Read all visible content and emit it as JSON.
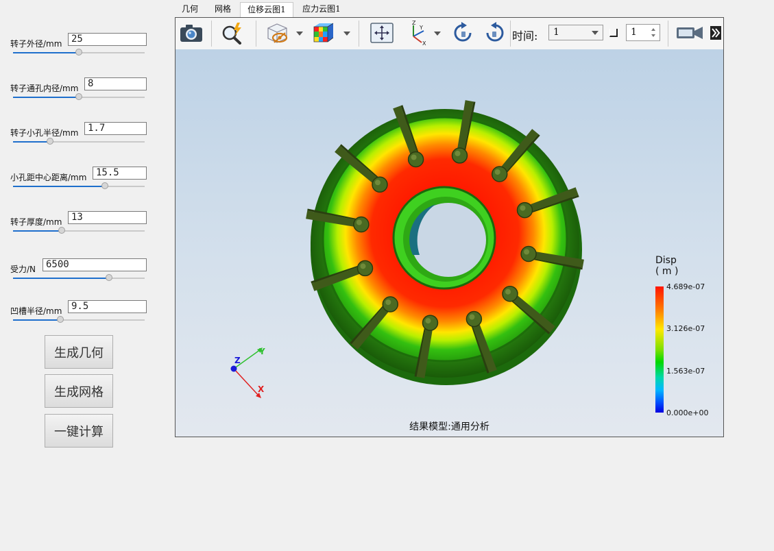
{
  "tabs": [
    {
      "label": "几何"
    },
    {
      "label": "网格"
    },
    {
      "label": "位移云图1"
    },
    {
      "label": "应力云图1"
    }
  ],
  "params": [
    {
      "label": "转子外径/mm",
      "value": "25",
      "slider_fraction": 0.5
    },
    {
      "label": "转子通孔内径/mm",
      "value": "8",
      "slider_fraction": 0.5
    },
    {
      "label": "转子小孔半径/mm",
      "value": "1.7",
      "slider_fraction": 0.28
    },
    {
      "label": "小孔距中心距离/mm",
      "value": "15.5",
      "slider_fraction": 0.7
    },
    {
      "label": "转子厚度/mm",
      "value": "13",
      "slider_fraction": 0.37
    },
    {
      "label": "受力/N",
      "value": "6500",
      "slider_fraction": 0.73
    },
    {
      "label": "凹槽半径/mm",
      "value": "9.5",
      "slider_fraction": 0.36
    }
  ],
  "buttons": {
    "generate_geometry": "生成几何",
    "generate_mesh": "生成网格",
    "one_click_compute": "一键计算"
  },
  "toolbar": {
    "time_label": "时间:",
    "time_value": "1",
    "frame_value": "1"
  },
  "legend": {
    "title": "Disp",
    "unit": "( m )",
    "ticks": [
      "4.689e-07",
      "3.126e-07",
      "1.563e-07",
      "0.000e+00"
    ]
  },
  "axes": {
    "x": "X",
    "y": "Y",
    "z": "Z"
  },
  "status": "结果模型:通用分析",
  "colors": {
    "slider_fill": "#1e6fcc",
    "ring_hot": "#ff2200",
    "ring_cool": "#2a9a10"
  }
}
